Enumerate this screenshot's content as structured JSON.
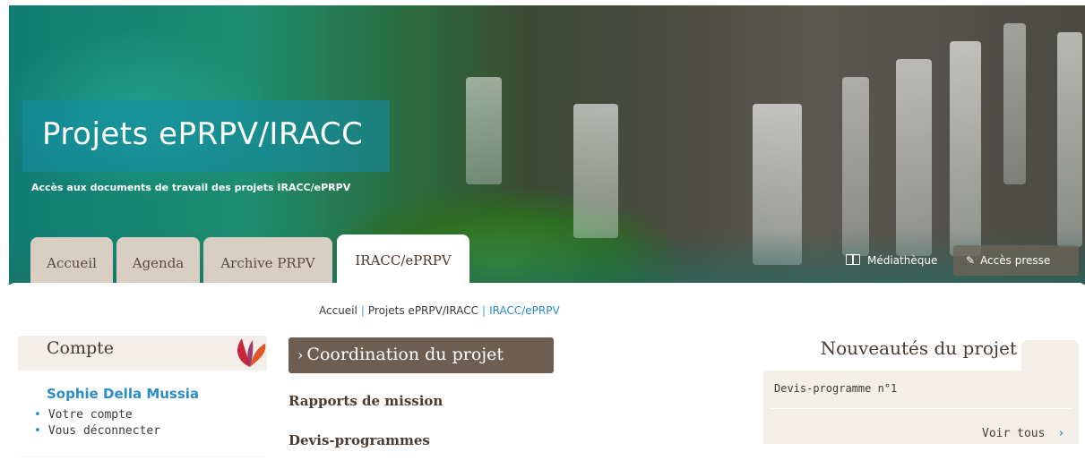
{
  "banner": {
    "title": "Projets ePRPV/IRACC",
    "subtitle": "Accès aux documents de travail des projets IRACC/ePRPV"
  },
  "tabs": [
    {
      "label": "Accueil"
    },
    {
      "label": "Agenda"
    },
    {
      "label": "Archive PRPV"
    },
    {
      "label": "IRACC/ePRPV",
      "active": true
    }
  ],
  "top_links": {
    "mediatheque": "Médiathèque",
    "acces_presse": "Accès presse"
  },
  "breadcrumb": {
    "items": [
      "Accueil",
      "Projets ePRPV/IRACC",
      "IRACC/ePRPV"
    ],
    "separator": "|"
  },
  "compte": {
    "title": "Compte",
    "user_name": "Sophie Della Mussia",
    "links": [
      "Votre compte",
      "Vous déconnecter"
    ]
  },
  "main": {
    "section_title": "Coordination du projet",
    "links": [
      "Rapports de mission",
      "Devis-programmes"
    ]
  },
  "news": {
    "title": "Nouveautés du projet",
    "items": [
      "Devis-programme n°1"
    ],
    "see_all": "Voir tous"
  },
  "colors": {
    "accent_blue": "#2a8cc8",
    "brown": "#6e5e52",
    "beige": "#f3eee7"
  }
}
